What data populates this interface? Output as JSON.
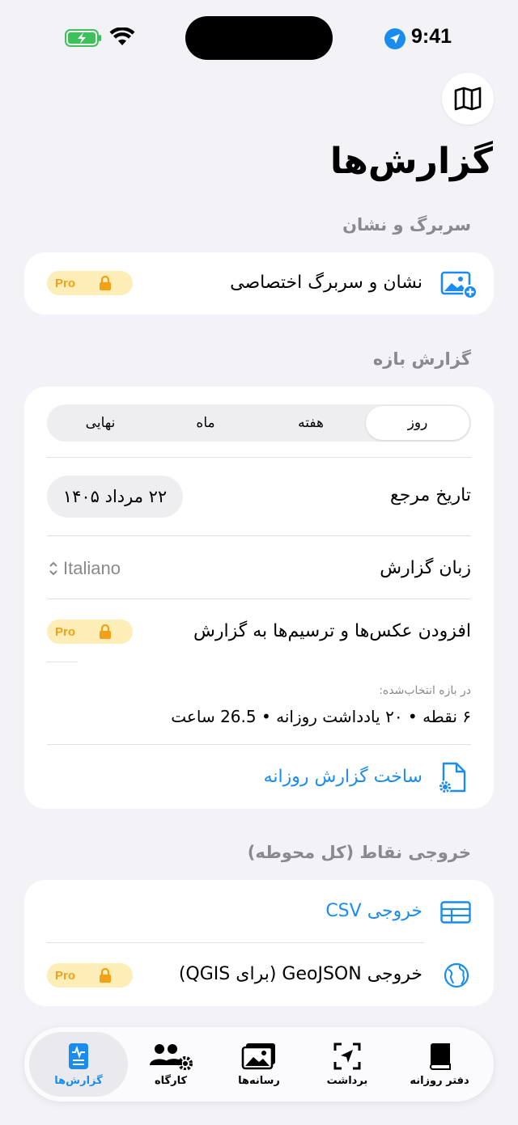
{
  "status_bar": {
    "time": "9:41"
  },
  "page": {
    "title": "گزارش‌ها"
  },
  "sections": {
    "watermark": {
      "label": "سربرگ و نشان",
      "custom_row": "نشان و سربرگ اختصاصی",
      "badge": "Pro"
    },
    "range_report": {
      "label": "گزارش بازه",
      "segments": [
        "روز",
        "هفته",
        "ماه",
        "نهایی"
      ],
      "selected_segment": "روز",
      "reference_date_label": "تاریخ مرجع",
      "reference_date_value": "۲۲ مرداد ۱۴۰۵",
      "language_label": "زبان گزارش",
      "language_value": "Italiano",
      "add_media_label": "افزودن عکس‌ها و ترسیم‌ها به گزارش",
      "add_media_badge": "Pro",
      "summary_caption": "در بازه انتخاب‌شده:",
      "summary_value": "۶ نقطه • ۲۰ یادداشت روزانه • 26.5 ساعت",
      "build_button": "ساخت گزارش روزانه"
    },
    "export": {
      "label": "خروجی نقاط (کل محوطه)",
      "csv": "خروجی CSV",
      "geojson": "خروجی GeoJSON (برای QGIS)",
      "geojson_badge": "Pro"
    }
  },
  "tabbar": {
    "tabs": [
      "گزارش‌ها",
      "کارگاه",
      "رسانه‌ها",
      "برداشت",
      "دفتر روزانه"
    ],
    "active": "گزارش‌ها"
  },
  "colors": {
    "accent": "#1a8cf0",
    "pro_bg": "#fdeeb8",
    "pro_fg": "#f3a016",
    "background": "#f2f2f7"
  }
}
